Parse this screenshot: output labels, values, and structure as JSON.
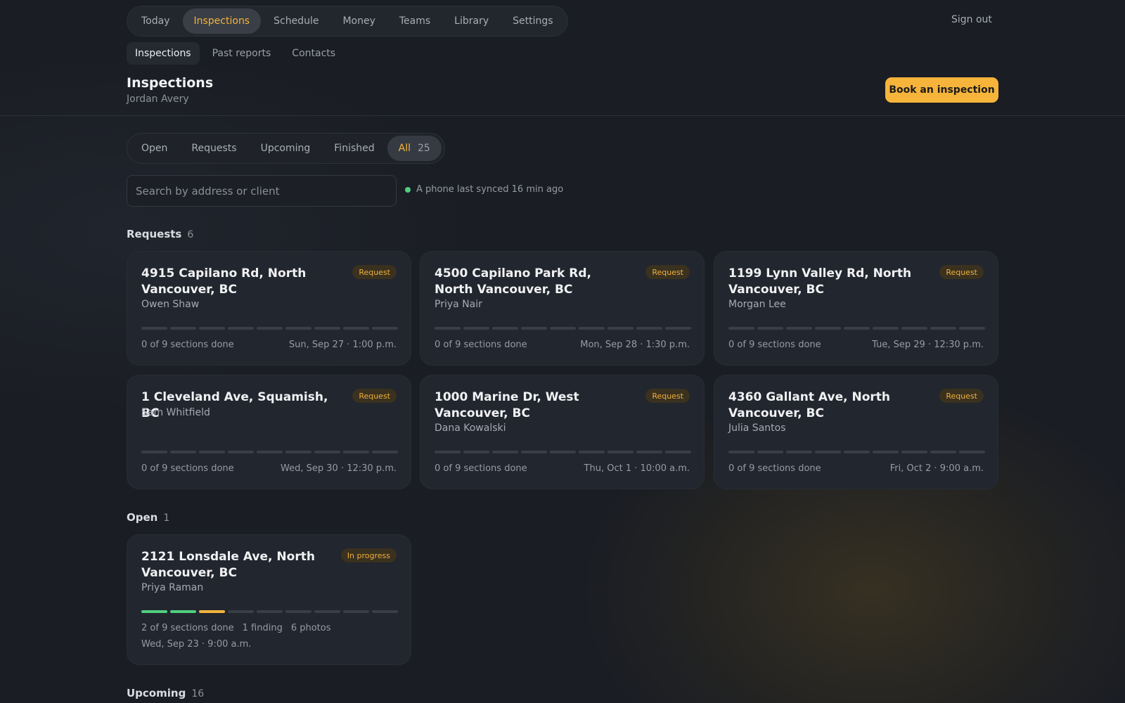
{
  "nav": {
    "items": [
      "Today",
      "Inspections",
      "Schedule",
      "Money",
      "Teams",
      "Library",
      "Settings"
    ],
    "active": "Inspections",
    "sign_out": "Sign out"
  },
  "subnav": {
    "items": [
      "Inspections",
      "Past reports",
      "Contacts"
    ],
    "active": "Inspections"
  },
  "header": {
    "title": "Inspections",
    "subtitle": "Jordan Avery",
    "book_button": "Book an inspection"
  },
  "filters": {
    "tabs": [
      "Open",
      "Requests",
      "Upcoming",
      "Finished",
      "All"
    ],
    "active": "All",
    "all_count": "25"
  },
  "search": {
    "placeholder": "Search by address or client"
  },
  "sync_status": "A phone last synced 16 min ago",
  "sections": {
    "requests": {
      "title": "Requests",
      "count": "6",
      "cards": [
        {
          "address": "4915 Capilano Rd, North Vancouver, BC",
          "client": "Owen Shaw",
          "badge": "Request",
          "progress": "0 of 9 sections done",
          "date": "Sun, Sep 27 · 1:00 p.m."
        },
        {
          "address": "4500 Capilano Park Rd, North Vancouver, BC",
          "client": "Priya Nair",
          "badge": "Request",
          "progress": "0 of 9 sections done",
          "date": "Mon, Sep 28 · 1:30 p.m."
        },
        {
          "address": "1199 Lynn Valley Rd, North Vancouver, BC",
          "client": "Morgan Lee",
          "badge": "Request",
          "progress": "0 of 9 sections done",
          "date": "Tue, Sep 29 · 12:30 p.m."
        },
        {
          "address": "1 Cleveland Ave, Squamish, BC",
          "client": "Sam Whitfield",
          "badge": "Request",
          "progress": "0 of 9 sections done",
          "date": "Wed, Sep 30 · 12:30 p.m."
        },
        {
          "address": "1000 Marine Dr, West Vancouver, BC",
          "client": "Dana Kowalski",
          "badge": "Request",
          "progress": "0 of 9 sections done",
          "date": "Thu, Oct 1 · 10:00 a.m."
        },
        {
          "address": "4360 Gallant Ave, North Vancouver, BC",
          "client": "Julia Santos",
          "badge": "Request",
          "progress": "0 of 9 sections done",
          "date": "Fri, Oct 2 · 9:00 a.m."
        }
      ]
    },
    "open": {
      "title": "Open",
      "count": "1",
      "cards": [
        {
          "address": "2121 Lonsdale Ave, North Vancouver, BC",
          "client": "Priya Raman",
          "badge": "In progress",
          "progress": "2 of 9 sections done",
          "findings": "1 finding",
          "photos": "6 photos",
          "date": "Wed, Sep 23 · 9:00 a.m.",
          "sections_done": 2,
          "sections_total": 9
        }
      ]
    },
    "upcoming": {
      "title": "Upcoming",
      "count": "16"
    }
  },
  "colors": {
    "accent": "#f6b43a",
    "success": "#4fcf7f",
    "background": "#1a1d23",
    "card": "#22262e"
  }
}
